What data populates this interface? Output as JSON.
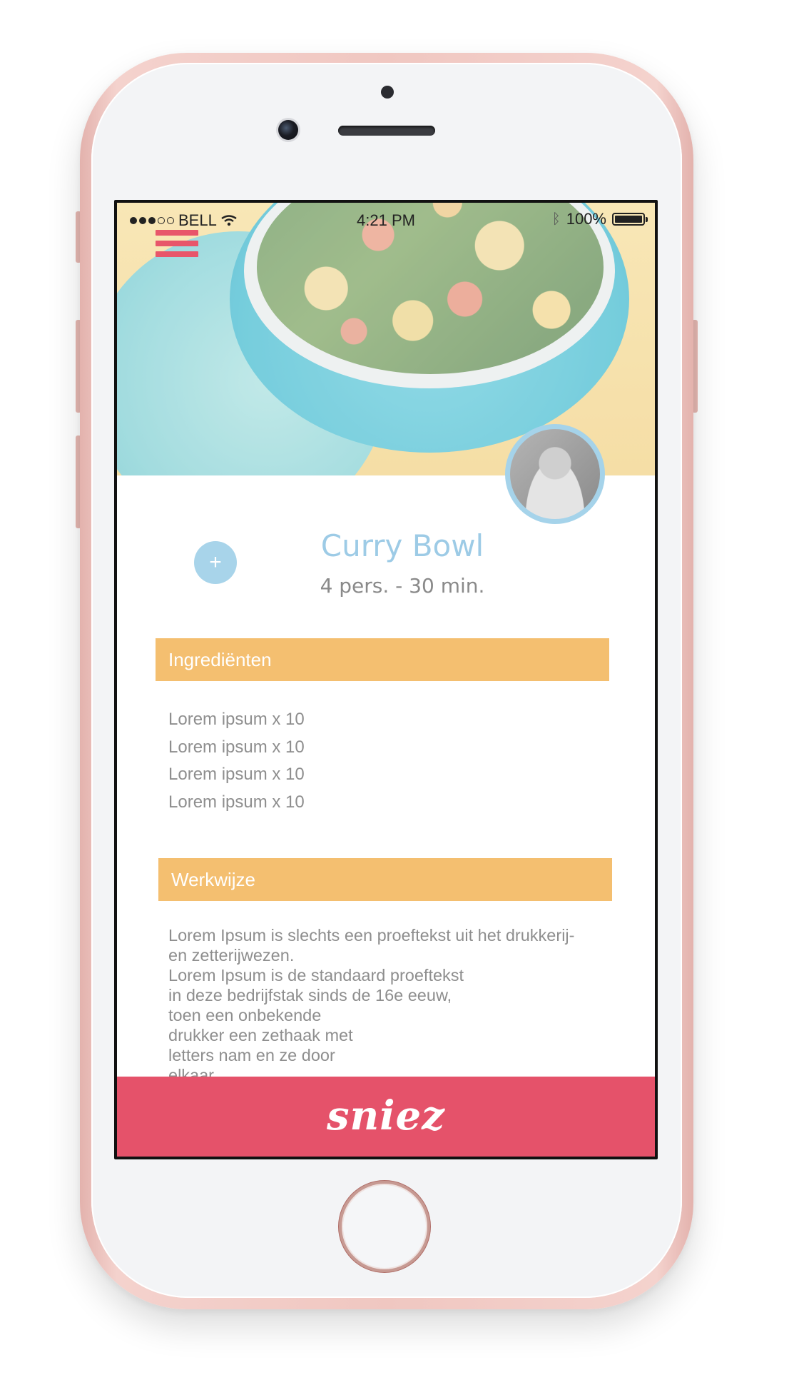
{
  "status_bar": {
    "carrier": "BELL",
    "time": "4:21 PM",
    "battery": "100%",
    "signal_bars": [
      true,
      true,
      true,
      false,
      false
    ]
  },
  "recipe": {
    "title": "Curry Bowl",
    "meta": "4 pers. - 30 min.",
    "add_label": "+"
  },
  "sections": {
    "ingredients": {
      "title": "Ingrediënten",
      "items": [
        "Lorem ipsum x 10",
        "Lorem ipsum x 10",
        "Lorem ipsum x 10",
        "Lorem ipsum x 10"
      ]
    },
    "method": {
      "title": "Werkwijze",
      "lines": [
        "Lorem Ipsum is slechts een proeftekst uit het drukkerij-",
        "en zetterijwezen.",
        "Lorem Ipsum is de standaard proeftekst",
        "in deze bedrijfstak sinds de 16e eeuw,",
        "toen een onbekende",
        "drukker een zethaak met",
        "letters nam en ze door",
        "elkaar"
      ]
    }
  },
  "footer": {
    "logo_text": "sniez"
  },
  "colors": {
    "accent": "#e5526a",
    "section_bar": "#f4bf70",
    "title": "#9dcbe6",
    "add_button": "#a8d4ea",
    "phone_body": "#f0c7c1"
  },
  "icons": [
    "signal-dots-icon",
    "wifi-icon",
    "bluetooth-icon",
    "battery-icon",
    "hamburger-menu-icon",
    "plus-icon"
  ]
}
